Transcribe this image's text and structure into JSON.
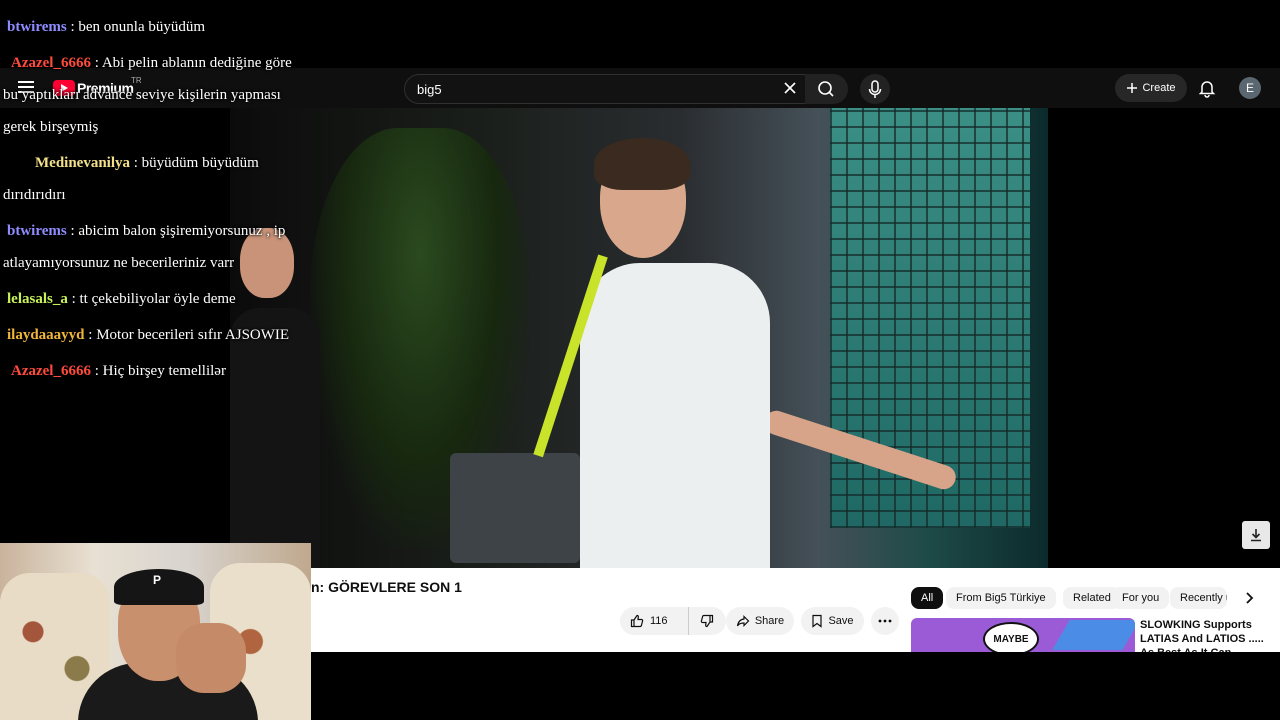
{
  "header": {
    "logo_text": "Premium",
    "logo_region": "TR",
    "search_value": "big5",
    "create_label": "Create",
    "avatar_letter": "E"
  },
  "video": {
    "title": "n: GÖREVLERE SON 1",
    "like_count": "116",
    "share_label": "Share",
    "save_label": "Save"
  },
  "chips": [
    "All",
    "From Big5 Türkiye",
    "Related",
    "For you",
    "Recently u"
  ],
  "recommendation": {
    "thumb_text": "MAYBE",
    "title": "SLOWKING Supports LATIAS And LATIOS ..... As Best As It Can. Pokémon"
  },
  "chat": [
    {
      "user": "btwirems",
      "color": "#8f8cff",
      "message": " : ben onunla büyüdüm",
      "lines": [
        "",
        ""
      ]
    },
    {
      "user": "Azazel_6666",
      "color": "#ff4a3d",
      "message": " : Abi pelin ablanın dediğine göre",
      "lines": [
        "bu yaptıkları advance seviye kişilerin yapması",
        "gerek birşeymiş"
      ]
    },
    {
      "user": "Medinevanilya",
      "color": "#f2e08a",
      "message": " : büyüdüm büyüdüm",
      "lines": [
        "dırıdırıdırı",
        ""
      ]
    },
    {
      "user": "btwirems",
      "color": "#8f8cff",
      "message": " : abicim balon şişiremiyorsunuz , ip",
      "lines": [
        "atlayamıyorsunuz ne becerileriniz varr",
        ""
      ]
    },
    {
      "user": "lelasals_a",
      "color": "#c9f25a",
      "message": " : tt çekebiliyolar öyle deme",
      "lines": [
        "",
        ""
      ]
    },
    {
      "user": "ilaydaaayyd",
      "color": "#f0b63a",
      "message": " : Motor becerileri sıfır AJSOWIE",
      "lines": [
        "",
        ""
      ]
    },
    {
      "user": "Azazel_6666",
      "color": "#ff4a3d",
      "message": " : Hiç birşey temellilər",
      "lines": [
        "",
        ""
      ]
    }
  ],
  "webcam": {
    "cap_letter": "P"
  },
  "icons": [
    "menu-icon",
    "youtube-logo-icon",
    "close-icon",
    "search-icon",
    "mic-icon",
    "plus-icon",
    "bell-icon",
    "thumbs-up-icon",
    "thumbs-down-icon",
    "share-icon",
    "bookmark-icon",
    "more-icon",
    "chevron-right-icon",
    "download-icon"
  ]
}
